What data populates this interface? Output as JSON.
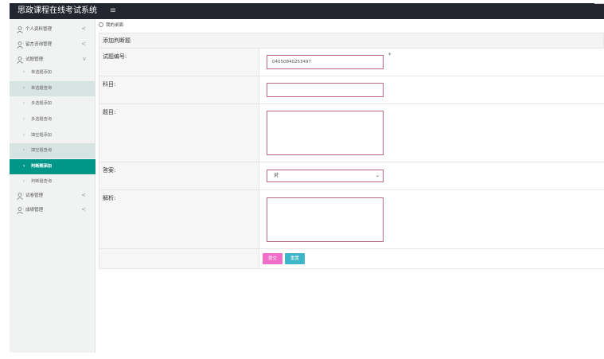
{
  "app": {
    "title": "思政课程在线考试系统",
    "menu_icon": "menu-icon"
  },
  "sidebar": {
    "groups": [
      {
        "label": "个人资料管理",
        "chevron": "<"
      },
      {
        "label": "留言咨询管理",
        "chevron": "<"
      },
      {
        "label": "试题管理",
        "chevron": "v"
      }
    ],
    "sub_items": [
      {
        "label": "单选题添加"
      },
      {
        "label": "单选题查询"
      },
      {
        "label": "多选题添加"
      },
      {
        "label": "多选题查询"
      },
      {
        "label": "填空题添加"
      },
      {
        "label": "填空题查询"
      },
      {
        "label": "判断题添加"
      },
      {
        "label": "判断题查询"
      }
    ],
    "groups_after": [
      {
        "label": "试卷管理",
        "chevron": "<"
      },
      {
        "label": "成绩管理",
        "chevron": "<"
      }
    ],
    "active_color": "#009688",
    "highlight_color": "#d6e4e2"
  },
  "breadcrumb": {
    "label": "我的桌面"
  },
  "panel": {
    "title": "添加判断题"
  },
  "form": {
    "id_label": "试题编号:",
    "id_value": "04050840253497",
    "required_mark": "*",
    "subject_label": "科目:",
    "subject_value": "",
    "question_label": "题目:",
    "question_value": "",
    "answer_label": "答案:",
    "answer_value": "对",
    "analysis_label": "解析:",
    "analysis_value": "",
    "submit_label": "提交",
    "reset_label": "重置"
  }
}
